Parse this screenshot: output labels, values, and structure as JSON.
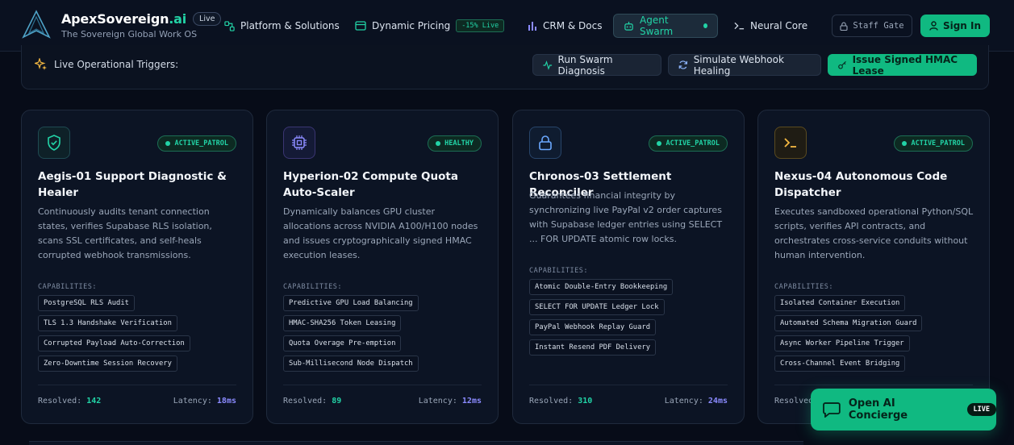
{
  "brand": {
    "name": "ApexSovereign",
    "suffix": ".ai",
    "live_pill": "Live",
    "tagline": "The Sovereign Global Work OS"
  },
  "nav": {
    "items": [
      {
        "label": "Platform & Solutions",
        "icon": "network-icon"
      },
      {
        "label": "Dynamic Pricing",
        "icon": "card-icon",
        "badge": "-15% Live"
      },
      {
        "label": "CRM & Docs",
        "icon": "bar-chart-icon"
      },
      {
        "label": "Agent Swarm",
        "icon": "robot-icon",
        "active": true
      },
      {
        "label": "Neural Core",
        "icon": "terminal-icon"
      }
    ],
    "staff_gate": "Staff Gate",
    "sign_in": "Sign In"
  },
  "triggers": {
    "label": "Live Operational Triggers:",
    "buttons": [
      {
        "label": "Run Swarm Diagnosis",
        "icon": "activity-icon"
      },
      {
        "label": "Simulate Webhook Healing",
        "icon": "refresh-icon"
      },
      {
        "label": "Issue Signed HMAC Lease",
        "icon": "key-icon"
      }
    ]
  },
  "cards": [
    {
      "icon": "shield-icon",
      "status": "ACTIVE_PATROL",
      "title": "Aegis-01 Support Diagnostic & Healer",
      "description": "Continuously audits tenant connection states, verifies Supabase RLS isolation, scans SSL certificates, and self-heals corrupted webhook transmissions.",
      "capabilities_label": "CAPABILITIES:",
      "capabilities": [
        "PostgreSQL RLS Audit",
        "TLS 1.3 Handshake Verification",
        "Corrupted Payload Auto-Correction",
        "Zero-Downtime Session Recovery"
      ],
      "resolved_label": "Resolved:",
      "resolved": "142",
      "latency_label": "Latency:",
      "latency": "18ms"
    },
    {
      "icon": "cpu-icon",
      "status": "HEALTHY",
      "title": "Hyperion-02 Compute Quota Auto-Scaler",
      "description": "Dynamically balances GPU cluster allocations across NVIDIA A100/H100 nodes and issues cryptographically signed HMAC execution leases.",
      "capabilities_label": "CAPABILITIES:",
      "capabilities": [
        "Predictive GPU Load Balancing",
        "HMAC-SHA256 Token Leasing",
        "Quota Overage Pre-emption",
        "Sub-Millisecond Node Dispatch"
      ],
      "resolved_label": "Resolved:",
      "resolved": "89",
      "latency_label": "Latency:",
      "latency": "12ms"
    },
    {
      "icon": "lock-icon",
      "status": "ACTIVE_PATROL",
      "title": "Chronos-03 Settlement Reconciler",
      "description": "Guarantees financial integrity by synchronizing live PayPal v2 order captures with Supabase ledger entries using SELECT ... FOR UPDATE atomic row locks.",
      "capabilities_label": "CAPABILITIES:",
      "capabilities": [
        "Atomic Double-Entry Bookkeeping",
        "SELECT FOR UPDATE Ledger Lock",
        "PayPal Webhook Replay Guard",
        "Instant Resend PDF Delivery"
      ],
      "resolved_label": "Resolved:",
      "resolved": "310",
      "latency_label": "Latency:",
      "latency": "24ms"
    },
    {
      "icon": "terminal-icon",
      "status": "ACTIVE_PATROL",
      "title": "Nexus-04 Autonomous Code Dispatcher",
      "description": "Executes sandboxed operational Python/SQL scripts, verifies API contracts, and orchestrates cross-service conduits without human intervention.",
      "capabilities_label": "CAPABILITIES:",
      "capabilities": [
        "Isolated Container Execution",
        "Automated Schema Migration Guard",
        "Async Worker Pipeline Trigger",
        "Cross-Channel Event Bridging"
      ],
      "resolved_label": "Resolved:"
    }
  ],
  "concierge": {
    "label": "Open AI Concierge",
    "live": "LIVE"
  }
}
